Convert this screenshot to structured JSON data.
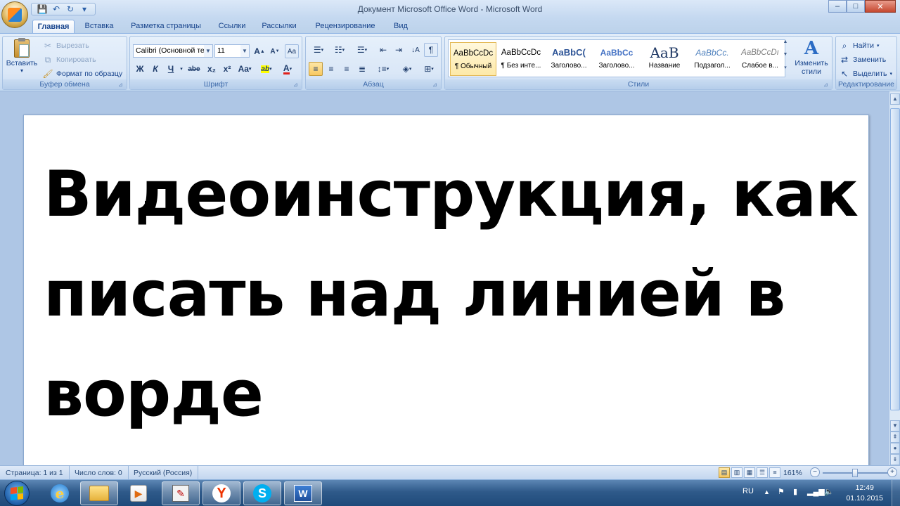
{
  "window": {
    "title": "Документ Microsoft Office Word - Microsoft Word",
    "controls": {
      "minimize": "–",
      "maximize": "□",
      "close": "✕"
    }
  },
  "qat": {
    "save": "💾",
    "undo": "↶",
    "redo": "↻",
    "more": "▾"
  },
  "tabs": [
    "Главная",
    "Вставка",
    "Разметка страницы",
    "Ссылки",
    "Рассылки",
    "Рецензирование",
    "Вид"
  ],
  "ribbon": {
    "clipboard": {
      "label": "Буфер обмена",
      "paste": "Вставить",
      "cut": "Вырезать",
      "copy": "Копировать",
      "format_painter": "Формат по образцу"
    },
    "font": {
      "label": "Шрифт",
      "font_name": "Calibri (Основной те",
      "font_size": "11",
      "grow": "A",
      "shrink": "A",
      "clear": "Aa",
      "bold": "Ж",
      "italic": "К",
      "underline": "Ч",
      "strike": "abe",
      "subscript": "x₂",
      "superscript": "x²",
      "case": "Aa",
      "highlight": "ab",
      "color": "A"
    },
    "paragraph": {
      "label": "Абзац"
    },
    "styles": {
      "label": "Стили",
      "items": [
        {
          "sample": "AaBbCcDc",
          "name": "¶ Обычный"
        },
        {
          "sample": "AaBbCcDc",
          "name": "¶ Без инте..."
        },
        {
          "sample": "AaBbC(",
          "name": "Заголово..."
        },
        {
          "sample": "AaBbCc",
          "name": "Заголово..."
        },
        {
          "sample": "AaB",
          "name": "Название"
        },
        {
          "sample": "AaBbCc.",
          "name": "Подзагол..."
        },
        {
          "sample": "AaBbCcDı",
          "name": "Слабое в..."
        }
      ],
      "change_styles": "Изменить стили"
    },
    "editing": {
      "label": "Редактирование",
      "find": "Найти",
      "replace": "Заменить",
      "select": "Выделить"
    }
  },
  "document": {
    "heading": "Видеоинструкция, как писать над линией в ворде"
  },
  "statusbar": {
    "page": "Страница: 1 из 1",
    "words": "Число слов: 0",
    "language": "Русский (Россия)",
    "zoom": "161%",
    "zoom_level_percent": 161
  },
  "taskbar": {
    "lang": "RU",
    "time": "12:49",
    "date": "01.10.2015"
  }
}
